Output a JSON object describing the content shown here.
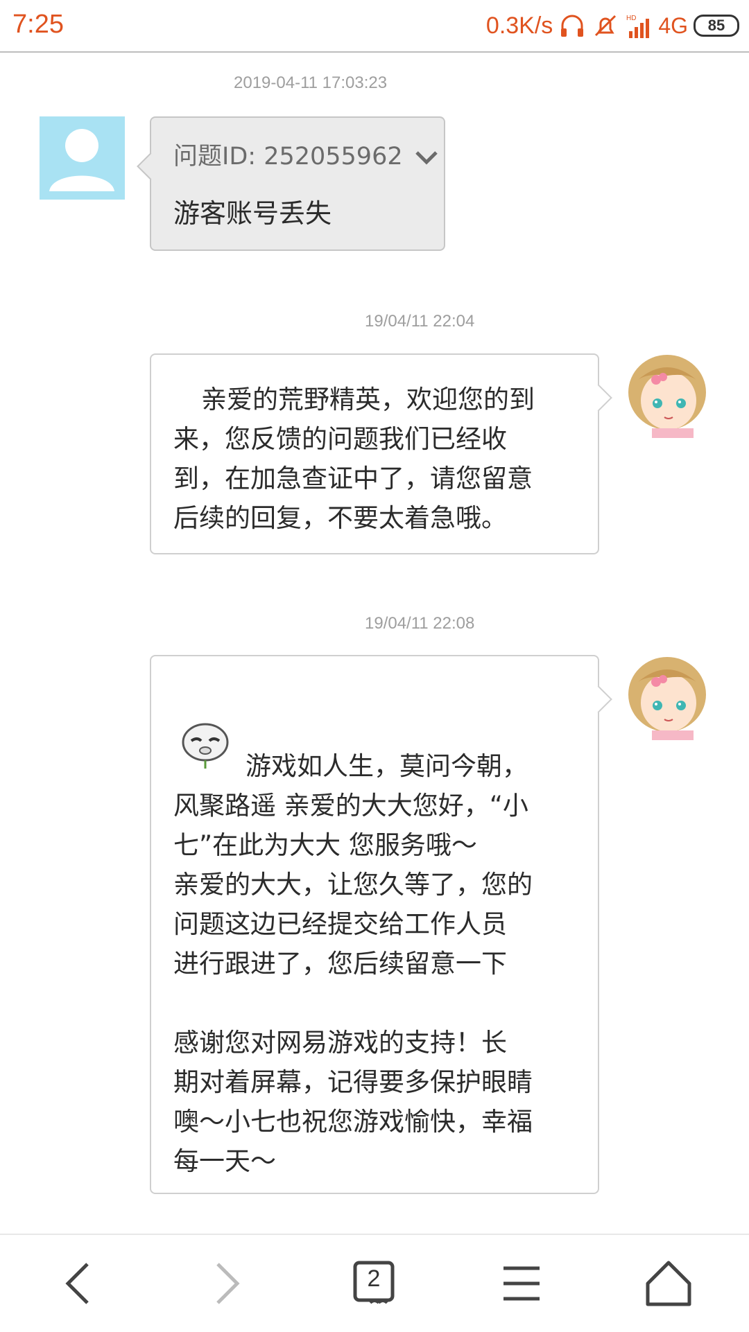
{
  "status_bar": {
    "time": "7:25",
    "net_speed": "0.3K/s",
    "network": "4G",
    "battery": "85",
    "icons": [
      "headphone-icon",
      "alarm-off-icon",
      "hd-signal-icon",
      "battery-icon"
    ]
  },
  "messages": [
    {
      "timestamp": "2019-04-11 17:03:23",
      "sender": "user",
      "question_label": "问题ID: 252055962",
      "text": "游客账号丢失"
    },
    {
      "timestamp": "19/04/11 22:04",
      "sender": "agent",
      "lines": [
        "亲爱的荒野精英，欢迎您的到",
        "来，您反馈的问题我们已经收",
        "到，在加急查证中了，请您留意",
        "后续的回复，不要太着急哦。"
      ]
    },
    {
      "timestamp": "19/04/11 22:08",
      "sender": "agent",
      "lines": [
        "游戏如人生，莫问今朝，",
        "风聚路遥  亲爱的大大您好，“小",
        "七”在此为大大 您服务哦～",
        "亲爱的大大，让您久等了，您的",
        "问题这边已经提交给工作人员",
        "进行跟进了，您后续留意一下",
        "",
        " 感谢您对网易游戏的支持！长",
        "期对着屏幕，记得要多保护眼睛",
        "噢～小七也祝您游戏愉快，幸福",
        "每一天～"
      ]
    }
  ],
  "bottom_nav": {
    "tab_count": "2",
    "items": [
      "back-icon",
      "forward-icon",
      "tabs-icon",
      "menu-icon",
      "home-icon"
    ]
  },
  "colors": {
    "status_accent": "#e0531f",
    "bubble_user_bg": "#ebebeb",
    "avatar_bg": "#a9e2f3"
  }
}
